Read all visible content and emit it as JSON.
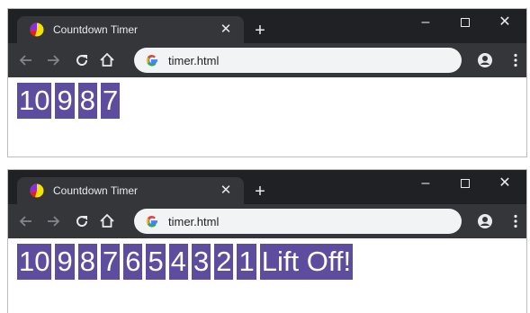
{
  "screenshot_top": {
    "tab": {
      "title": "Countdown Timer",
      "close_label": "✕"
    },
    "new_tab_label": "+",
    "window_controls": {
      "minimize": "–",
      "close": "✕"
    },
    "address_bar": {
      "url": "timer.html"
    },
    "countdown": [
      "10",
      "9",
      "8",
      "7"
    ]
  },
  "screenshot_bottom": {
    "tab": {
      "title": "Countdown Timer",
      "close_label": "✕"
    },
    "new_tab_label": "+",
    "window_controls": {
      "minimize": "–",
      "close": "✕"
    },
    "address_bar": {
      "url": "timer.html"
    },
    "countdown": [
      "10",
      "9",
      "8",
      "7",
      "6",
      "5",
      "4",
      "3",
      "2",
      "1",
      "Lift Off!"
    ]
  },
  "colors": {
    "titlebar": "#202124",
    "toolbar": "#35363a",
    "countdown_box": "#5d4d9e"
  },
  "icons": [
    "favicon-pie-icon",
    "back-arrow-icon",
    "forward-arrow-icon",
    "reload-icon",
    "home-icon",
    "google-g-icon",
    "profile-icon",
    "menu-dots-icon",
    "maximize-icon"
  ]
}
